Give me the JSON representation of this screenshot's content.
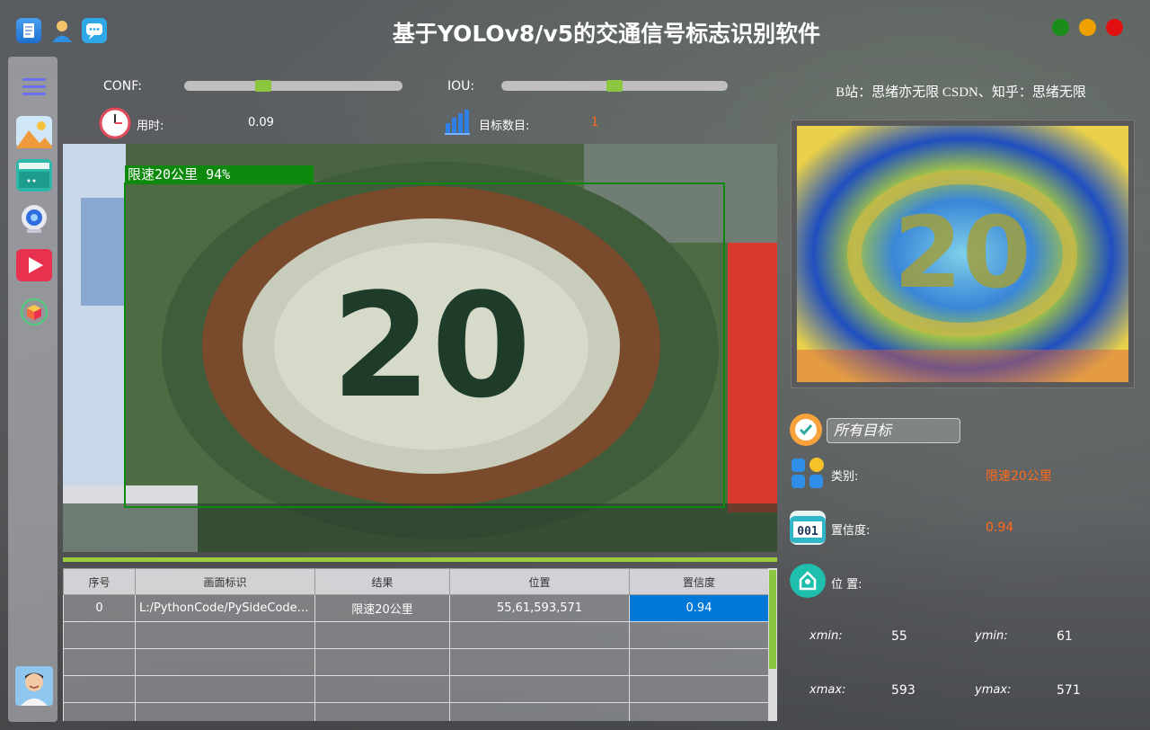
{
  "app": {
    "title": "基于YOLOv8/v5的交通信号标志识别软件"
  },
  "header": {
    "icons": [
      "document-icon",
      "user-icon",
      "chat-icon"
    ],
    "window_buttons": [
      {
        "name": "maximize-button",
        "color": "#1a8c1a"
      },
      {
        "name": "minimize-button",
        "color": "#f0a000"
      },
      {
        "name": "close-button",
        "color": "#e01010"
      }
    ]
  },
  "sidebar": {
    "items": [
      "menu-icon",
      "image-icon",
      "folder-icon",
      "camera-icon",
      "video-icon",
      "model-icon"
    ],
    "avatar": "avatar"
  },
  "controls": {
    "conf_label": "CONF:",
    "conf_value": 0.35,
    "iou_label": "IOU:",
    "iou_value": 0.5,
    "time_label": "用时:",
    "time_value": "0.09",
    "count_label": "目标数目:",
    "count_value": "1"
  },
  "credit": "B站：思绪亦无限  CSDN、知乎：思绪无限",
  "detection": {
    "box_label": "限速20公里  94%",
    "sign_text": "20"
  },
  "table": {
    "headers": [
      "序号",
      "画面标识",
      "结果",
      "位置",
      "置信度"
    ],
    "rows": [
      [
        "0",
        "L:/PythonCode/PySideCode/...",
        "限速20公里",
        "55,61,593,571",
        "0.94"
      ],
      [
        "",
        "",
        "",
        "",
        ""
      ],
      [
        "",
        "",
        "",
        "",
        ""
      ],
      [
        "",
        "",
        "",
        "",
        ""
      ],
      [
        "",
        "",
        "",
        "",
        ""
      ]
    ]
  },
  "right": {
    "crop_text": "20",
    "target_select": "所有目标",
    "class_label": "类别:",
    "class_value": "限速20公里",
    "conf_label": "置信度:",
    "conf_value": "0.94",
    "pos_label": "位 置:",
    "xmin_label": "xmin:",
    "xmin": "55",
    "ymin_label": "ymin:",
    "ymin": "61",
    "xmax_label": "xmax:",
    "xmax": "593",
    "ymax_label": "ymax:",
    "ymax": "571"
  }
}
